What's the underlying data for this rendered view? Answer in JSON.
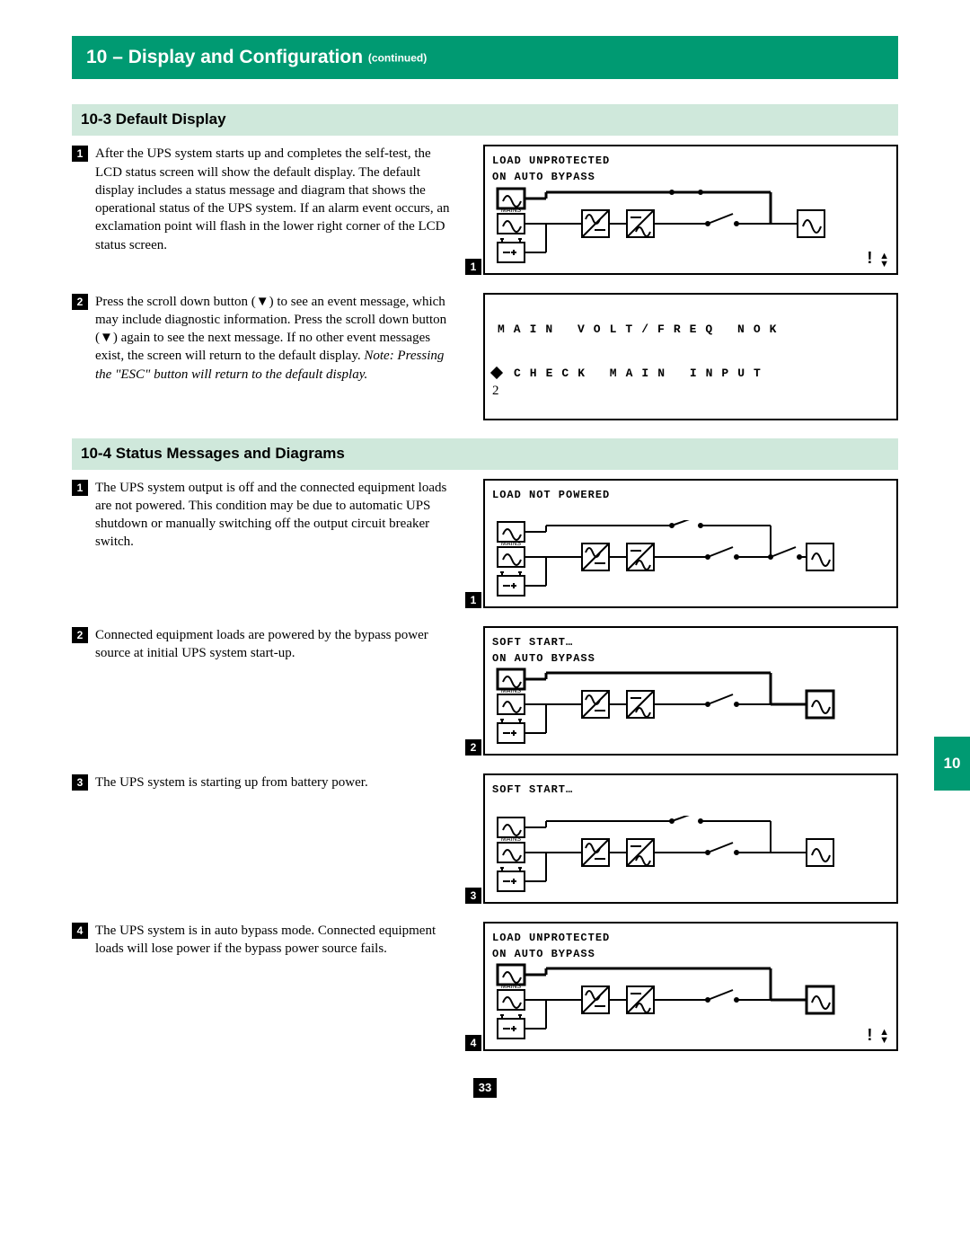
{
  "chapter": {
    "label": "10 – Display and Configuration",
    "continued": "(continued)"
  },
  "side_tab": "10",
  "page_number": "33",
  "sections": {
    "s1": {
      "heading": "10-3 Default Display",
      "items": [
        {
          "num": "1",
          "text": "After the UPS system starts up and completes the self-test, the LCD status screen will show the default display. The default display includes a status message and diagram that shows the operational status of the UPS system. If an alarm event occurs, an exclamation point will flash in the lower right corner of the LCD status screen.",
          "panel": {
            "line1": "LOAD UNPROTECTED",
            "line2": "ON AUTO BYPASS",
            "tag": "1",
            "bypa_bold": true,
            "excl": true
          }
        },
        {
          "num": "2",
          "text_pre": "Press the scroll down button (",
          "text_mid1": ") to see an event message, which may include diagnostic information. Press the scroll down button (",
          "text_mid2": ") again to see the next message. If no other event messages exist, the screen will return to the default display. ",
          "note": "Note: Pressing the \"ESC\" button will return to the default display.",
          "msg_panel": {
            "line1": "MAIN  VOLT/FREQ  NOK",
            "line2": "CHECK  MAIN  INPUT",
            "tag": "2"
          }
        }
      ]
    },
    "s2": {
      "heading": "10-4 Status Messages and Diagrams",
      "items": [
        {
          "num": "1",
          "text": "The UPS system output is off and the connected equipment loads are not powered. This condition may be due to automatic UPS shutdown or manually switching off the output circuit breaker switch.",
          "panel": {
            "line1": "LOAD NOT POWERED",
            "line2": "",
            "tag": "1",
            "bypa_bold": false,
            "excl": false,
            "open_switches": true
          }
        },
        {
          "num": "2",
          "text": "Connected equipment loads are powered by the bypass power source at initial UPS system start-up.",
          "panel": {
            "line1": "SOFT START…",
            "line2": "ON AUTO BYPASS",
            "tag": "2",
            "bypa_bold": true,
            "excl": false,
            "open_switches": true
          }
        },
        {
          "num": "3",
          "text": "The UPS system is starting up from battery power.",
          "panel": {
            "line1": "SOFT START…",
            "line2": "",
            "tag": "3",
            "bypa_bold": false,
            "excl": false,
            "open_switches": true
          }
        },
        {
          "num": "4",
          "text": "The UPS system is in auto bypass mode. Connected equipment loads will lose power if the bypass power source fails.",
          "panel": {
            "line1": "LOAD UNPROTECTED",
            "line2": "ON AUTO BYPASS",
            "tag": "4",
            "bypa_bold": true,
            "excl": true,
            "open_switches": true
          }
        }
      ]
    }
  }
}
